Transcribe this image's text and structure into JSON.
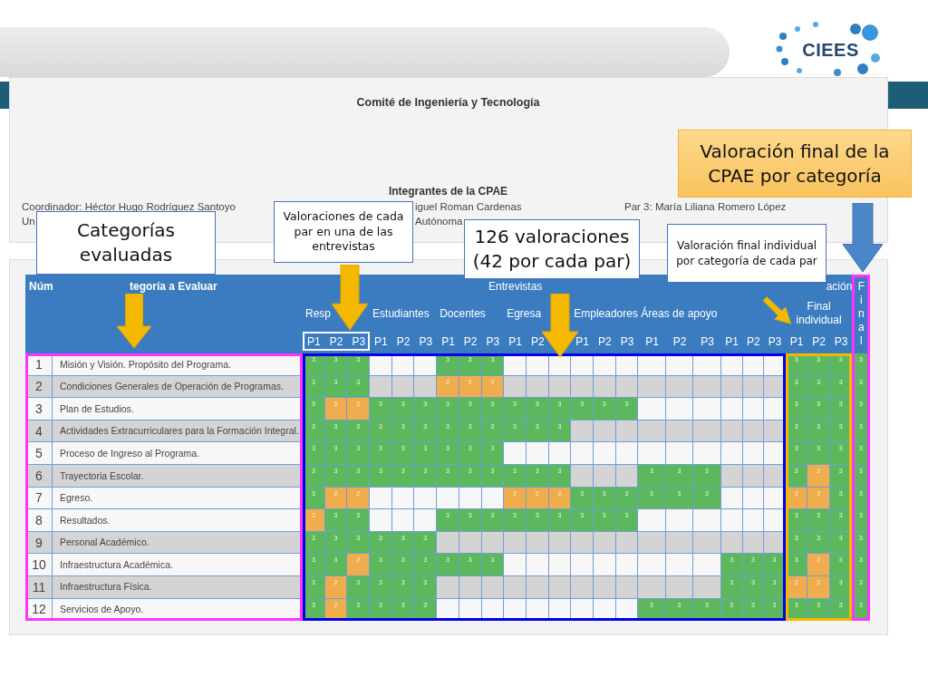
{
  "logo": {
    "text": "CIEES"
  },
  "committee": {
    "title": "Comité de Ingeniería y Tecnología",
    "members_heading": "Integrantes de la CPAE",
    "members": [
      {
        "lines": [
          "Coordinador: Héctor Hugo Rodríguez Santoyo",
          "Un"
        ]
      },
      {
        "lines": [
          "iguel Roman Cardenas",
          "Autónoma"
        ]
      },
      {
        "lines": [
          "Par 3: María Liliana Romero López"
        ]
      }
    ]
  },
  "table": {
    "header": {
      "number": "Núm",
      "category": "tegoría a Evaluar",
      "interviews": "Entrevistas",
      "results": "ación",
      "final_individual": "Final individual",
      "final": "Final"
    },
    "groups": [
      {
        "label": "Resp",
        "subcolumns": [
          "P1",
          "P2",
          "P3"
        ]
      },
      {
        "label": "Estudiantes",
        "subcolumns": [
          "P1",
          "P2",
          "P3"
        ]
      },
      {
        "label": "Docentes",
        "subcolumns": [
          "P1",
          "P2",
          "P3"
        ]
      },
      {
        "label": "Egresa",
        "subcolumns": [
          "P1",
          "P2"
        ]
      },
      {
        "label": "Empleadores",
        "subcolumns": [
          "P1",
          "P2",
          "P3"
        ]
      },
      {
        "label": "Áreas de apoyo",
        "subcolumns": [
          "P1",
          "P2",
          "P3"
        ]
      },
      {
        "subcolumns": [
          "P1",
          "P2",
          "P3"
        ]
      }
    ],
    "final_individual_subcolumns": [
      "P1",
      "P2",
      "P3"
    ],
    "rows": [
      {
        "number": "1",
        "category": "Misión y Visión. Propósito del Programa.",
        "shaded": false,
        "ratings": [
          {
            "kind": "rated",
            "value": "3"
          },
          {
            "kind": "rated",
            "value": "3"
          },
          {
            "kind": "rated",
            "value": "3"
          },
          {
            "kind": "blank"
          },
          {
            "kind": "blank"
          },
          {
            "kind": "blank"
          },
          {
            "kind": "rated",
            "value": "3"
          },
          {
            "kind": "rated",
            "value": "3"
          },
          {
            "kind": "rated",
            "value": "3"
          },
          {
            "kind": "blank"
          },
          {
            "kind": "blank"
          },
          {
            "kind": "blank"
          },
          {
            "kind": "blank"
          },
          {
            "kind": "blank"
          },
          {
            "kind": "blank"
          },
          {
            "kind": "blank"
          },
          {
            "kind": "blank"
          },
          {
            "kind": "blank"
          },
          {
            "kind": "blank"
          },
          {
            "kind": "blank"
          },
          {
            "kind": "blank"
          }
        ],
        "final_individual": [
          "3",
          "3",
          "3"
        ],
        "final": "3"
      },
      {
        "number": "2",
        "category": "Condiciones Generales de Operación de Programas.",
        "shaded": true,
        "ratings": [
          {
            "kind": "rated",
            "value": "3"
          },
          {
            "kind": "rated",
            "value": "3"
          },
          {
            "kind": "rated",
            "value": "3"
          },
          {
            "kind": "blank"
          },
          {
            "kind": "blank"
          },
          {
            "kind": "blank"
          },
          {
            "kind": "rated",
            "value": "2"
          },
          {
            "kind": "rated",
            "value": "2"
          },
          {
            "kind": "rated",
            "value": "2"
          },
          {
            "kind": "blank"
          },
          {
            "kind": "blank"
          },
          {
            "kind": "blank"
          },
          {
            "kind": "blank"
          },
          {
            "kind": "blank"
          },
          {
            "kind": "blank"
          },
          {
            "kind": "blank"
          },
          {
            "kind": "blank"
          },
          {
            "kind": "blank"
          },
          {
            "kind": "blank"
          },
          {
            "kind": "blank"
          },
          {
            "kind": "blank"
          }
        ],
        "final_individual": [
          "3",
          "3",
          "3"
        ],
        "final": "3"
      },
      {
        "number": "3",
        "category": "Plan de Estudios.",
        "shaded": false,
        "ratings": [
          {
            "kind": "rated",
            "value": "3"
          },
          {
            "kind": "rated",
            "value": "2"
          },
          {
            "kind": "rated",
            "value": "2"
          },
          {
            "kind": "rated",
            "value": "3"
          },
          {
            "kind": "rated",
            "value": "3"
          },
          {
            "kind": "rated",
            "value": "3"
          },
          {
            "kind": "rated",
            "value": "3"
          },
          {
            "kind": "rated",
            "value": "3"
          },
          {
            "kind": "rated",
            "value": "3"
          },
          {
            "kind": "rated",
            "value": "3"
          },
          {
            "kind": "rated",
            "value": "3"
          },
          {
            "kind": "rated",
            "value": "3"
          },
          {
            "kind": "rated",
            "value": "3"
          },
          {
            "kind": "rated",
            "value": "3"
          },
          {
            "kind": "rated",
            "value": "3"
          },
          {
            "kind": "blank"
          },
          {
            "kind": "blank"
          },
          {
            "kind": "blank"
          },
          {
            "kind": "blank"
          },
          {
            "kind": "blank"
          },
          {
            "kind": "blank"
          }
        ],
        "final_individual": [
          "3",
          "3",
          "3"
        ],
        "final": "3"
      },
      {
        "number": "4",
        "category": "Actividades Extracurriculares para la Formación Integral.",
        "shaded": true,
        "ratings": [
          {
            "kind": "rated",
            "value": "3"
          },
          {
            "kind": "rated",
            "value": "3"
          },
          {
            "kind": "rated",
            "value": "3"
          },
          {
            "kind": "rated",
            "value": "3"
          },
          {
            "kind": "rated",
            "value": "3"
          },
          {
            "kind": "rated",
            "value": "3"
          },
          {
            "kind": "rated",
            "value": "3"
          },
          {
            "kind": "rated",
            "value": "3"
          },
          {
            "kind": "rated",
            "value": "3"
          },
          {
            "kind": "rated",
            "value": "3"
          },
          {
            "kind": "rated",
            "value": "3"
          },
          {
            "kind": "rated",
            "value": "3"
          },
          {
            "kind": "blank"
          },
          {
            "kind": "blank"
          },
          {
            "kind": "blank"
          },
          {
            "kind": "blank"
          },
          {
            "kind": "blank"
          },
          {
            "kind": "blank"
          },
          {
            "kind": "blank"
          },
          {
            "kind": "blank"
          },
          {
            "kind": "blank"
          }
        ],
        "final_individual": [
          "3",
          "3",
          "3"
        ],
        "final": "3"
      },
      {
        "number": "5",
        "category": "Proceso de Ingreso al Programa.",
        "shaded": false,
        "ratings": [
          {
            "kind": "rated",
            "value": "3"
          },
          {
            "kind": "rated",
            "value": "3"
          },
          {
            "kind": "rated",
            "value": "3"
          },
          {
            "kind": "rated",
            "value": "3"
          },
          {
            "kind": "rated",
            "value": "3"
          },
          {
            "kind": "rated",
            "value": "3"
          },
          {
            "kind": "rated",
            "value": "3"
          },
          {
            "kind": "rated",
            "value": "3"
          },
          {
            "kind": "rated",
            "value": "3"
          },
          {
            "kind": "blank"
          },
          {
            "kind": "blank"
          },
          {
            "kind": "blank"
          },
          {
            "kind": "blank"
          },
          {
            "kind": "blank"
          },
          {
            "kind": "blank"
          },
          {
            "kind": "blank"
          },
          {
            "kind": "blank"
          },
          {
            "kind": "blank"
          },
          {
            "kind": "blank"
          },
          {
            "kind": "blank"
          },
          {
            "kind": "blank"
          }
        ],
        "final_individual": [
          "3",
          "3",
          "3"
        ],
        "final": "3"
      },
      {
        "number": "6",
        "category": "Trayectoria Escolar.",
        "shaded": true,
        "ratings": [
          {
            "kind": "rated",
            "value": "3"
          },
          {
            "kind": "rated",
            "value": "3"
          },
          {
            "kind": "rated",
            "value": "3"
          },
          {
            "kind": "rated",
            "value": "3"
          },
          {
            "kind": "rated",
            "value": "3"
          },
          {
            "kind": "rated",
            "value": "3"
          },
          {
            "kind": "rated",
            "value": "3"
          },
          {
            "kind": "rated",
            "value": "3"
          },
          {
            "kind": "rated",
            "value": "3"
          },
          {
            "kind": "rated",
            "value": "3"
          },
          {
            "kind": "rated",
            "value": "3"
          },
          {
            "kind": "rated",
            "value": "3"
          },
          {
            "kind": "blank"
          },
          {
            "kind": "blank"
          },
          {
            "kind": "blank"
          },
          {
            "kind": "rated",
            "value": "3"
          },
          {
            "kind": "rated",
            "value": "3"
          },
          {
            "kind": "rated",
            "value": "3"
          },
          {
            "kind": "blank"
          },
          {
            "kind": "blank"
          },
          {
            "kind": "blank"
          }
        ],
        "final_individual": [
          "3",
          "2",
          "3"
        ],
        "final": "3"
      },
      {
        "number": "7",
        "category": "Egreso.",
        "shaded": false,
        "ratings": [
          {
            "kind": "rated",
            "value": "3"
          },
          {
            "kind": "rated",
            "value": "2"
          },
          {
            "kind": "rated",
            "value": "2"
          },
          {
            "kind": "blank"
          },
          {
            "kind": "blank"
          },
          {
            "kind": "blank"
          },
          {
            "kind": "blank"
          },
          {
            "kind": "blank"
          },
          {
            "kind": "blank"
          },
          {
            "kind": "rated",
            "value": "2"
          },
          {
            "kind": "rated",
            "value": "2"
          },
          {
            "kind": "rated",
            "value": "2"
          },
          {
            "kind": "rated",
            "value": "3"
          },
          {
            "kind": "rated",
            "value": "3"
          },
          {
            "kind": "rated",
            "value": "3"
          },
          {
            "kind": "rated",
            "value": "3"
          },
          {
            "kind": "rated",
            "value": "3"
          },
          {
            "kind": "rated",
            "value": "3"
          },
          {
            "kind": "blank"
          },
          {
            "kind": "blank"
          },
          {
            "kind": "blank"
          }
        ],
        "final_individual": [
          "2",
          "2",
          "3"
        ],
        "final": "3"
      },
      {
        "number": "8",
        "category": "Resultados.",
        "shaded": false,
        "ratings": [
          {
            "kind": "rated",
            "value": "2"
          },
          {
            "kind": "rated",
            "value": "3"
          },
          {
            "kind": "rated",
            "value": "3"
          },
          {
            "kind": "blank"
          },
          {
            "kind": "blank"
          },
          {
            "kind": "blank"
          },
          {
            "kind": "rated",
            "value": "3"
          },
          {
            "kind": "rated",
            "value": "3"
          },
          {
            "kind": "rated",
            "value": "3"
          },
          {
            "kind": "rated",
            "value": "3"
          },
          {
            "kind": "rated",
            "value": "3"
          },
          {
            "kind": "rated",
            "value": "3"
          },
          {
            "kind": "rated",
            "value": "3"
          },
          {
            "kind": "rated",
            "value": "3"
          },
          {
            "kind": "rated",
            "value": "3"
          },
          {
            "kind": "blank"
          },
          {
            "kind": "blank"
          },
          {
            "kind": "blank"
          },
          {
            "kind": "blank"
          },
          {
            "kind": "blank"
          },
          {
            "kind": "blank"
          }
        ],
        "final_individual": [
          "3",
          "3",
          "3"
        ],
        "final": "3"
      },
      {
        "number": "9",
        "category": "Personal Académico.",
        "shaded": true,
        "ratings": [
          {
            "kind": "rated",
            "value": "3"
          },
          {
            "kind": "rated",
            "value": "3"
          },
          {
            "kind": "rated",
            "value": "3"
          },
          {
            "kind": "rated",
            "value": "3"
          },
          {
            "kind": "rated",
            "value": "3"
          },
          {
            "kind": "rated",
            "value": "3"
          },
          {
            "kind": "blank"
          },
          {
            "kind": "blank"
          },
          {
            "kind": "blank"
          },
          {
            "kind": "blank"
          },
          {
            "kind": "blank"
          },
          {
            "kind": "blank"
          },
          {
            "kind": "blank"
          },
          {
            "kind": "blank"
          },
          {
            "kind": "blank"
          },
          {
            "kind": "blank"
          },
          {
            "kind": "blank"
          },
          {
            "kind": "blank"
          },
          {
            "kind": "blank"
          },
          {
            "kind": "blank"
          },
          {
            "kind": "blank"
          }
        ],
        "final_individual": [
          "3",
          "3",
          "3"
        ],
        "final": "3"
      },
      {
        "number": "10",
        "category": "Infraestructura Académica.",
        "shaded": false,
        "ratings": [
          {
            "kind": "rated",
            "value": "3"
          },
          {
            "kind": "rated",
            "value": "3"
          },
          {
            "kind": "rated",
            "value": "2"
          },
          {
            "kind": "rated",
            "value": "3"
          },
          {
            "kind": "rated",
            "value": "3"
          },
          {
            "kind": "rated",
            "value": "3"
          },
          {
            "kind": "rated",
            "value": "3"
          },
          {
            "kind": "rated",
            "value": "3"
          },
          {
            "kind": "rated",
            "value": "3"
          },
          {
            "kind": "blank"
          },
          {
            "kind": "blank"
          },
          {
            "kind": "blank"
          },
          {
            "kind": "blank"
          },
          {
            "kind": "blank"
          },
          {
            "kind": "blank"
          },
          {
            "kind": "blank"
          },
          {
            "kind": "blank"
          },
          {
            "kind": "blank"
          },
          {
            "kind": "rated",
            "value": "3"
          },
          {
            "kind": "rated",
            "value": "3"
          },
          {
            "kind": "rated",
            "value": "3"
          }
        ],
        "final_individual": [
          "3",
          "2",
          "3"
        ],
        "final": "3"
      },
      {
        "number": "11",
        "category": "Infraestructura Física.",
        "shaded": true,
        "ratings": [
          {
            "kind": "rated",
            "value": "3"
          },
          {
            "kind": "rated",
            "value": "2"
          },
          {
            "kind": "rated",
            "value": "3"
          },
          {
            "kind": "rated",
            "value": "3"
          },
          {
            "kind": "rated",
            "value": "3"
          },
          {
            "kind": "rated",
            "value": "3"
          },
          {
            "kind": "blank"
          },
          {
            "kind": "blank"
          },
          {
            "kind": "blank"
          },
          {
            "kind": "blank"
          },
          {
            "kind": "blank"
          },
          {
            "kind": "blank"
          },
          {
            "kind": "blank"
          },
          {
            "kind": "blank"
          },
          {
            "kind": "blank"
          },
          {
            "kind": "blank"
          },
          {
            "kind": "blank"
          },
          {
            "kind": "blank"
          },
          {
            "kind": "rated",
            "value": "3"
          },
          {
            "kind": "rated",
            "value": "3"
          },
          {
            "kind": "rated",
            "value": "3"
          }
        ],
        "final_individual": [
          "2",
          "2",
          "3"
        ],
        "final": "3"
      },
      {
        "number": "12",
        "category": "Servicios de Apoyo.",
        "shaded": false,
        "ratings": [
          {
            "kind": "rated",
            "value": "3"
          },
          {
            "kind": "rated",
            "value": "2"
          },
          {
            "kind": "rated",
            "value": "3"
          },
          {
            "kind": "rated",
            "value": "3"
          },
          {
            "kind": "rated",
            "value": "3"
          },
          {
            "kind": "rated",
            "value": "3"
          },
          {
            "kind": "blank"
          },
          {
            "kind": "blank"
          },
          {
            "kind": "blank"
          },
          {
            "kind": "blank"
          },
          {
            "kind": "blank"
          },
          {
            "kind": "blank"
          },
          {
            "kind": "blank"
          },
          {
            "kind": "blank"
          },
          {
            "kind": "blank"
          },
          {
            "kind": "rated",
            "value": "3"
          },
          {
            "kind": "rated",
            "value": "3"
          },
          {
            "kind": "rated",
            "value": "3"
          },
          {
            "kind": "rated",
            "value": "3"
          },
          {
            "kind": "rated",
            "value": "3"
          },
          {
            "kind": "rated",
            "value": "3"
          }
        ],
        "final_individual": [
          "3",
          "3",
          "3"
        ],
        "final": "3"
      }
    ]
  },
  "callouts": [
    {
      "text": "Valoración final de la CPAE por categoría",
      "kind": "highlight"
    },
    {
      "text": "Categorías evaluadas",
      "kind": "note"
    },
    {
      "text": "Valoraciones de cada par en una de las entrevistas",
      "kind": "note"
    },
    {
      "text": "126 valoraciones (42 por cada par)",
      "kind": "note"
    },
    {
      "text": "Valoración final individual por categoría de cada par",
      "kind": "note"
    }
  ]
}
